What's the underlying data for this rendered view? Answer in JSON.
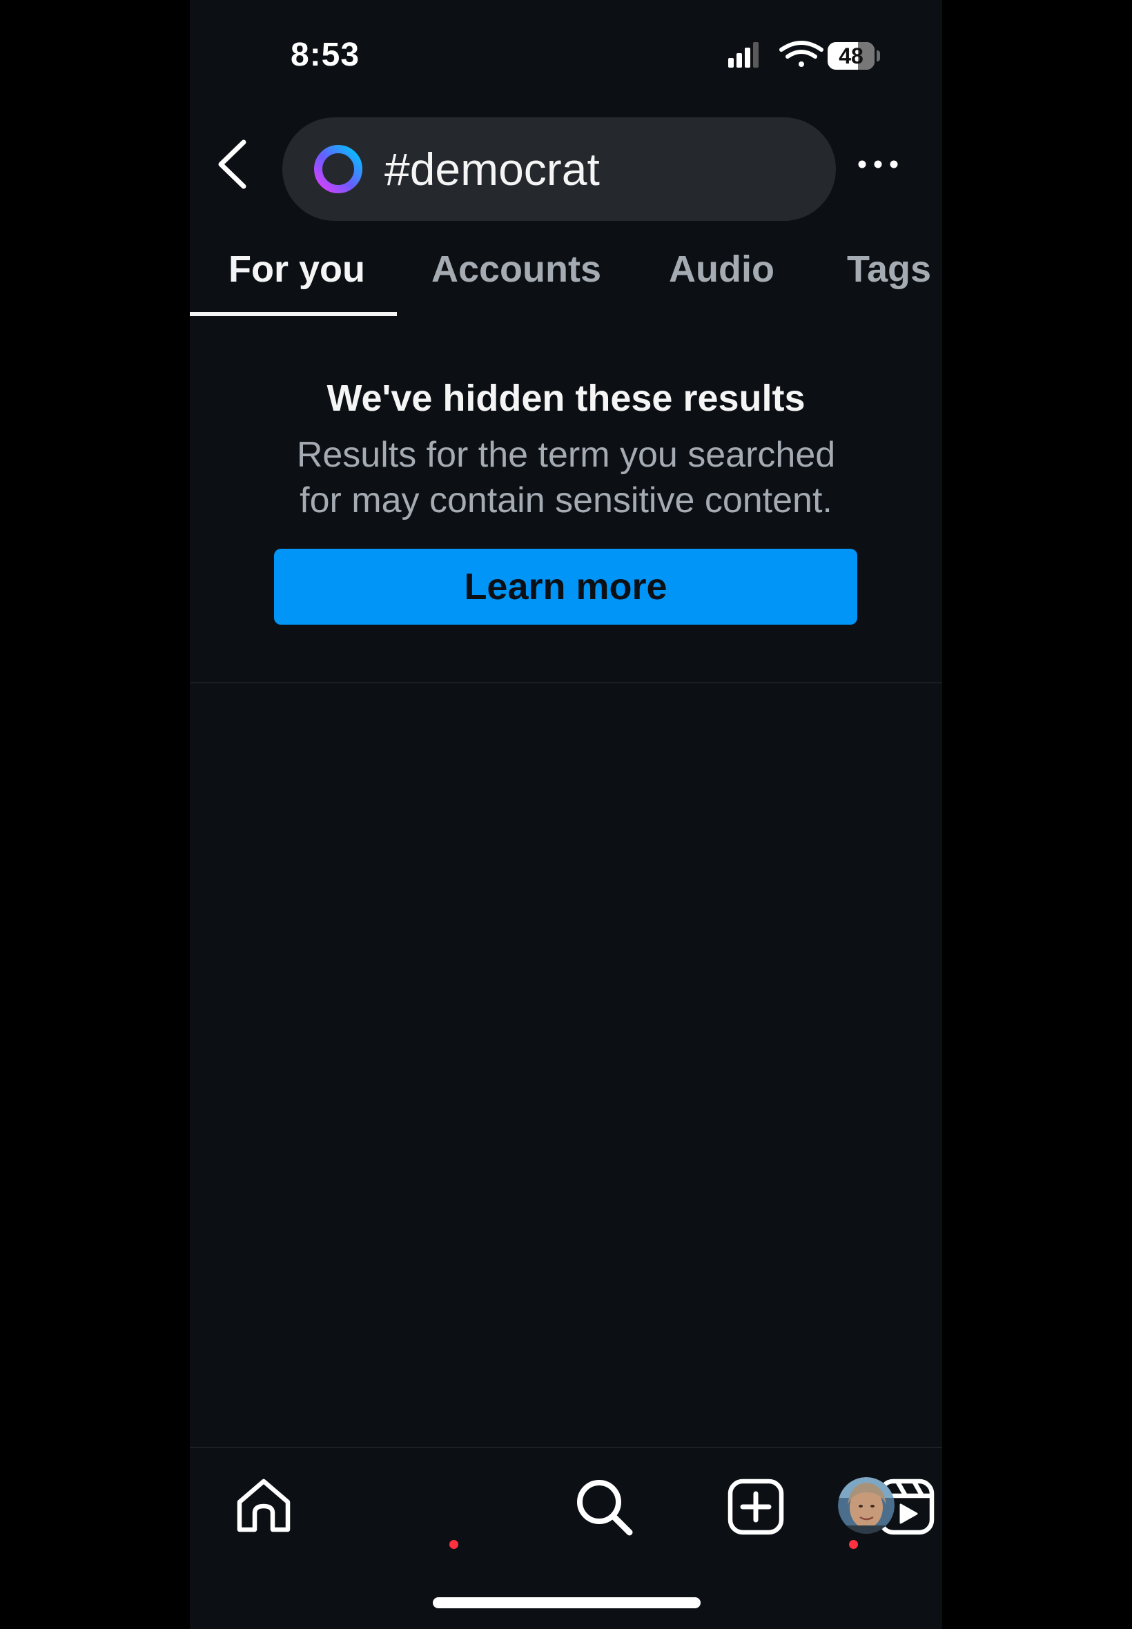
{
  "status_bar": {
    "time": "8:53",
    "battery": "48",
    "icons": [
      "signal-icon",
      "wifi-icon",
      "battery-icon"
    ]
  },
  "header": {
    "back_icon": "chevron-left-icon",
    "search_query": "#democrat",
    "search_logo": "meta-ai-ring-icon",
    "more_icon": "more-horizontal-icon"
  },
  "tabs": [
    {
      "label": "For you",
      "active": true
    },
    {
      "label": "Accounts",
      "active": false
    },
    {
      "label": "Audio",
      "active": false
    },
    {
      "label": "Tags",
      "active": false
    }
  ],
  "notice": {
    "title": "We've hidden these results",
    "body": "Results for the term you searched for may contain sensitive content.",
    "button_label": "Learn more"
  },
  "bottom_nav": {
    "items": [
      {
        "icon": "home-icon",
        "notification_dot": true
      },
      {
        "icon": "search-icon",
        "notification_dot": false
      },
      {
        "icon": "create-post-icon",
        "notification_dot": false
      },
      {
        "icon": "reels-icon",
        "notification_dot": false
      },
      {
        "icon": "profile-avatar",
        "notification_dot": true
      }
    ]
  },
  "colors": {
    "background": "#0c1014",
    "primary_text": "#f5f5f5",
    "secondary_text": "#a5abb3",
    "accent_blue": "#0095f6",
    "notification_red": "#ff3040",
    "search_pill": "#25292e"
  }
}
